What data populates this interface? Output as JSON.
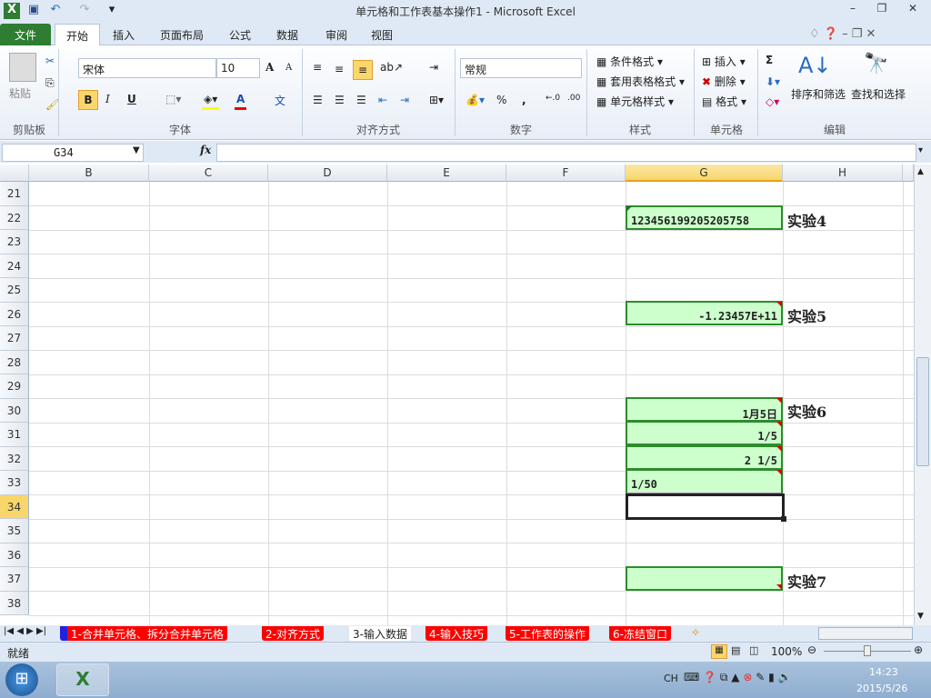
{
  "window": {
    "title": "单元格和工作表基本操作1  -  Microsoft Excel"
  },
  "ribbon_tabs": [
    "文件",
    "开始",
    "插入",
    "页面布局",
    "公式",
    "数据",
    "审阅",
    "视图"
  ],
  "clipboard": {
    "paste": "粘贴",
    "group": "剪贴板"
  },
  "font": {
    "name": "宋体",
    "size": "10",
    "group": "字体",
    "bold": "B",
    "italic": "I",
    "underline": "U",
    "grow": "A",
    "shrink": "A",
    "color": "A",
    "phonetic": "文"
  },
  "alignment": {
    "group": "对齐方式"
  },
  "number": {
    "format": "常规",
    "group": "数字",
    "percent": "%",
    "comma": ",",
    "inc": "←.0",
    "dec": ".00"
  },
  "styles": {
    "conditional": "条件格式",
    "table": "套用表格格式",
    "cell": "单元格样式",
    "group": "样式"
  },
  "cells_group": {
    "insert": "插入",
    "delete": "删除",
    "format": "格式",
    "group": "单元格"
  },
  "editing": {
    "sum": "Σ",
    "sort": "排序和筛选",
    "find": "查找和选择",
    "group": "编辑"
  },
  "formula_bar": {
    "name_box": "G34",
    "fx": "fx",
    "value": ""
  },
  "columns": [
    "B",
    "C",
    "D",
    "E",
    "F",
    "G",
    "H"
  ],
  "rows": [
    "21",
    "22",
    "23",
    "24",
    "25",
    "26",
    "27",
    "28",
    "29",
    "30",
    "31",
    "32",
    "33",
    "34",
    "35",
    "36",
    "37",
    "38"
  ],
  "cells": {
    "G22": "123456199205205758",
    "G26": "-1.23457E+11",
    "G30": "1月5日",
    "G31": "1/5",
    "G32": "2 1/5",
    "G33": "1/50",
    "G37": ""
  },
  "notes": {
    "H22": "实验4",
    "H26": "实验5",
    "H30": "实验6",
    "H37": "实验7"
  },
  "sheets": [
    "1-合并单元格、拆分合并单元格",
    "2-对齐方式",
    "3-输入数据",
    "4-输入技巧",
    "5-工作表的操作",
    "6-冻结窗口"
  ],
  "status": {
    "ready": "就绪",
    "zoom": "100%"
  },
  "taskbar": {
    "lang": "CH",
    "time": "14:23",
    "date": "2015/5/26"
  }
}
